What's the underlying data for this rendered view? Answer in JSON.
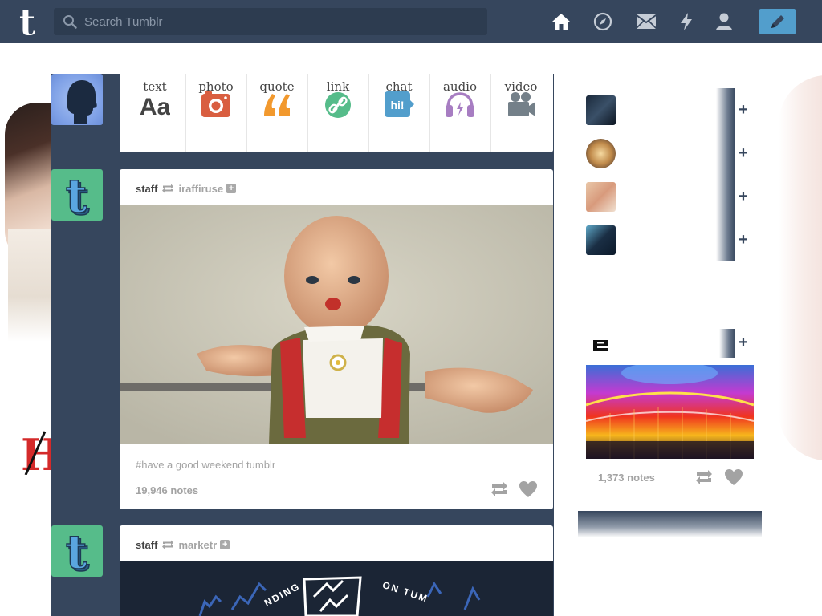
{
  "topbar": {
    "logo_letter": "t",
    "search_placeholder": "Search Tumblr",
    "nav": [
      "home-icon",
      "explore-icon",
      "inbox-icon",
      "activity-icon",
      "account-icon"
    ],
    "compose_icon": "pencil-icon"
  },
  "colors": {
    "navy": "#36465d",
    "compose_blue": "#529ecc",
    "text_grey": "#a3a3a3",
    "photo_red": "#d95e40",
    "quote_orange": "#f2992e",
    "link_green": "#56bc8a",
    "chat_blue": "#529ecc",
    "audio_purple": "#a77dc2",
    "video_grey": "#748089"
  },
  "post_types": [
    {
      "label": "text",
      "glyph": "Aa",
      "icon": "text-icon"
    },
    {
      "label": "photo",
      "icon": "camera-icon"
    },
    {
      "label": "quote",
      "icon": "quote-icon"
    },
    {
      "label": "link",
      "icon": "link-icon"
    },
    {
      "label": "chat",
      "glyph": "hi!",
      "icon": "chat-icon"
    },
    {
      "label": "audio",
      "icon": "headphones-icon"
    },
    {
      "label": "video",
      "icon": "video-camera-icon"
    }
  ],
  "posts": [
    {
      "author": "staff",
      "reblogged_from": "iraffiruse",
      "tag": "#have a good weekend tumblr",
      "notes": "19,946 notes"
    },
    {
      "author": "staff",
      "reblogged_from": "marketr",
      "image_text": [
        "NDING",
        "ON TUM"
      ]
    }
  ],
  "sidebar": {
    "recommended_count": 4,
    "radar_notes": "1,373 notes",
    "follow_glyph": "+"
  },
  "background": {
    "left_mark": "H"
  }
}
